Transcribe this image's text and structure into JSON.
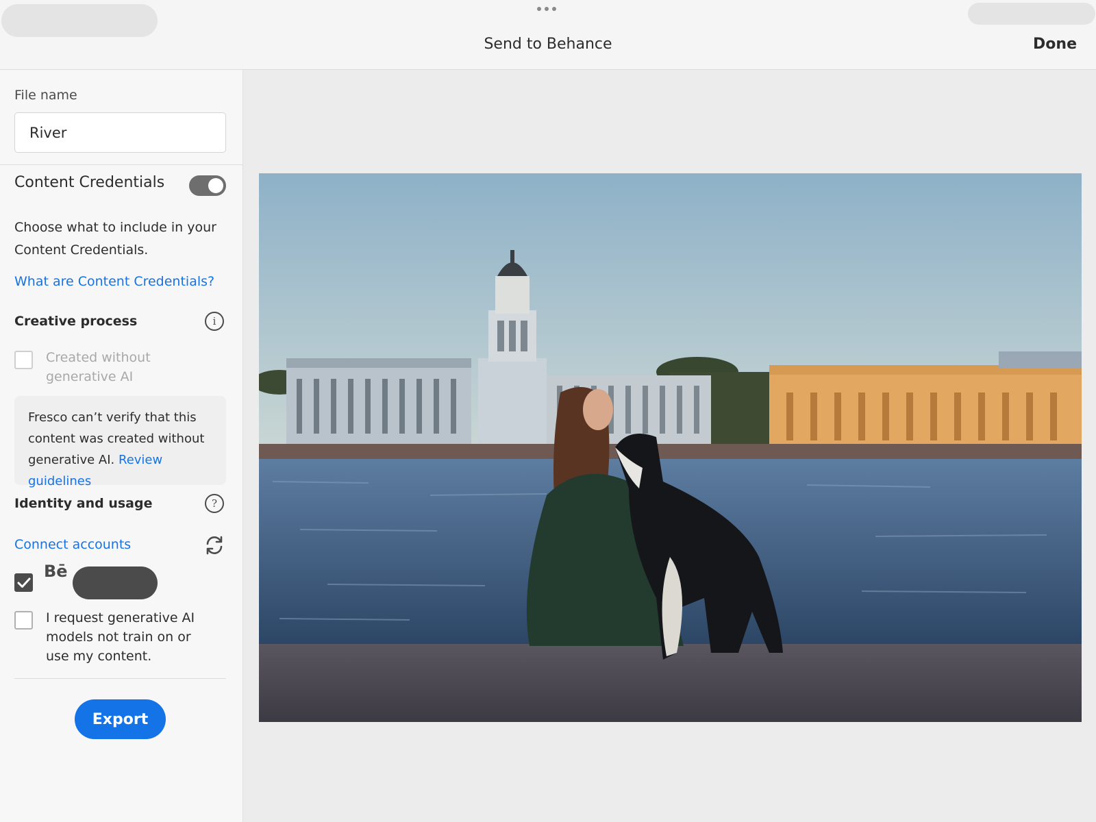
{
  "header": {
    "title": "Send to Behance",
    "done_label": "Done"
  },
  "sidebar": {
    "file_name_label": "File name",
    "file_name_value": "River",
    "content_credentials": {
      "title": "Content Credentials",
      "enabled": true,
      "description": "Choose what to include in your Content Credentials.",
      "learn_link": "What are Content Credentials?"
    },
    "creative_process": {
      "title": "Creative process",
      "checkbox_label": "Created without generative AI",
      "checkbox_checked": false,
      "notice_text": "Fresco can’t verify that this content was created without generative AI. ",
      "notice_link": "Review guidelines"
    },
    "identity_usage": {
      "title": "Identity and usage",
      "connect_link": "Connect accounts",
      "behance_logo": "Bē",
      "behance_checked": true,
      "ai_opt_out_label": "I request generative AI models not train on or use my content.",
      "ai_opt_out_checked": false
    },
    "export_label": "Export"
  },
  "icons": {
    "info": "info-icon",
    "help": "help-icon",
    "refresh": "refresh-icon",
    "checkmark": "checkmark-icon"
  },
  "colors": {
    "accent": "#1473e6",
    "toggle_on": "#6e6e6e",
    "checked": "#4b4b4b"
  }
}
